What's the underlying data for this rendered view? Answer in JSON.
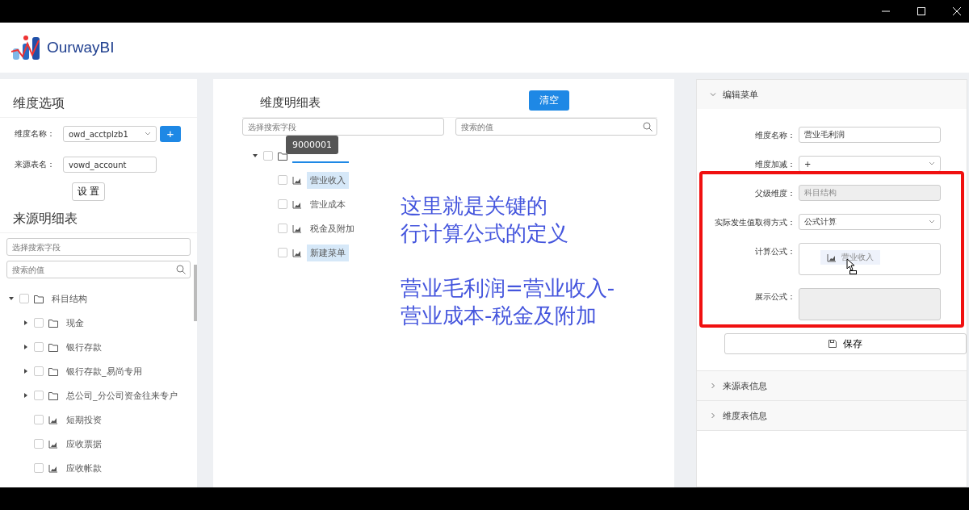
{
  "app": {
    "brand": "OurwayBI"
  },
  "left_panel": {
    "title": "维度选项",
    "fields": [
      {
        "label": "维度名称：",
        "kind": "select",
        "value": "owd_acctplzb1",
        "add_button": "+"
      },
      {
        "label": "来源表名：",
        "kind": "input",
        "value": "vowd_account"
      }
    ],
    "set_button": "设 置",
    "source_title": "来源明细表",
    "search_field": {
      "placeholder": "选择搜索字段"
    },
    "search_value": {
      "placeholder": "搜索的值"
    },
    "tree": [
      {
        "label": "科目结构",
        "kind": "folder",
        "expanded": true,
        "checked": false,
        "children": [
          {
            "label": "现金",
            "kind": "folder",
            "expanded": false,
            "checked": false
          },
          {
            "label": "银行存款",
            "kind": "folder",
            "expanded": false,
            "checked": false
          },
          {
            "label": "银行存款_易尚专用",
            "kind": "folder",
            "expanded": false,
            "checked": false
          },
          {
            "label": "总公司_分公司资金往来专户",
            "kind": "folder",
            "expanded": false,
            "checked": false
          },
          {
            "label": "短期投资",
            "kind": "leaf",
            "checked": false
          },
          {
            "label": "应收票据",
            "kind": "leaf",
            "checked": false
          },
          {
            "label": "应收帐款",
            "kind": "leaf",
            "checked": false
          }
        ]
      }
    ]
  },
  "middle_panel": {
    "title": "维度明细表",
    "clear_button": "清空",
    "search_field": {
      "placeholder": "选择搜索字段"
    },
    "search_value": {
      "placeholder": "搜索的值"
    },
    "tree": [
      {
        "kind": "folder",
        "expanded": true,
        "checked": false,
        "tooltip": "9000001",
        "children": [
          {
            "label": "营业收入",
            "kind": "leaf",
            "checked": false,
            "selected": true
          },
          {
            "label": "营业成本",
            "kind": "leaf",
            "checked": false,
            "selected": false
          },
          {
            "label": "税金及附加",
            "kind": "leaf",
            "checked": false,
            "selected": false
          },
          {
            "label": "新建菜单",
            "kind": "leaf",
            "checked": false,
            "selected": true
          }
        ]
      }
    ]
  },
  "annotation": {
    "lines": [
      "这里就是关键的",
      "行计算公式的定义",
      "营业毛利润=营业收入-",
      "营业成本-税金及附加"
    ]
  },
  "right_panel": {
    "sections": [
      {
        "title": "编辑菜单",
        "expanded": true,
        "fields": [
          {
            "label": "维度名称：",
            "kind": "input",
            "value": "营业毛利润",
            "disabled": false
          },
          {
            "label": "维度加减：",
            "kind": "select",
            "value": "+",
            "disabled": false
          },
          {
            "label": "父级维度：",
            "kind": "input",
            "value": "科目结构",
            "disabled": true
          },
          {
            "label": "实际发生值取得方式：",
            "kind": "select",
            "value": "公式计算",
            "disabled": false
          },
          {
            "label": "计算公式：",
            "kind": "textarea",
            "chip": "营业收入",
            "disabled": false
          },
          {
            "label": "展示公式：",
            "kind": "textarea",
            "disabled": true
          }
        ],
        "save_button": "保存"
      },
      {
        "title": "来源表信息",
        "expanded": false
      },
      {
        "title": "维度表信息",
        "expanded": false
      }
    ]
  }
}
